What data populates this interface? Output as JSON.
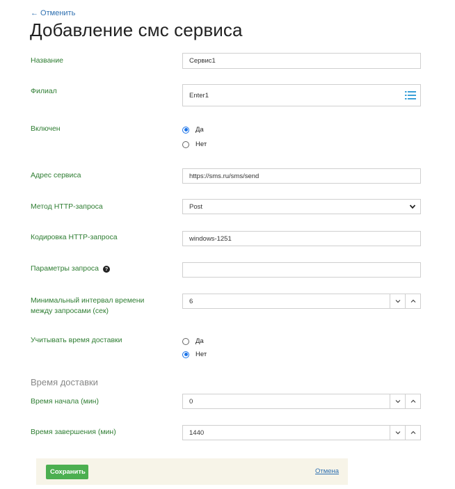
{
  "header": {
    "back_label": "← Отменить",
    "title": "Добавление смс сервиса"
  },
  "form": {
    "name": {
      "label": "Название",
      "value": "Сервис1"
    },
    "branch": {
      "label": "Филиал",
      "value": "Enter1",
      "icon": "list-icon"
    },
    "enabled": {
      "label": "Включен",
      "options": [
        {
          "label": "Да",
          "checked": true
        },
        {
          "label": "Нет",
          "checked": false
        }
      ]
    },
    "service_address": {
      "label": "Адрес сервиса",
      "value": "https://sms.ru/sms/send"
    },
    "http_method": {
      "label": "Метод HTTP-запроса",
      "value": "Post"
    },
    "http_encoding": {
      "label": "Кодировка HTTP-запроса",
      "value": "windows-1251"
    },
    "request_params": {
      "label": "Параметры запроса",
      "value": ""
    },
    "min_interval": {
      "label_line1": "Минимальный интервал времени",
      "label_line2": "между запросами (сек)",
      "value": "6"
    },
    "consider_delivery_time": {
      "label": "Учитывать время доставки",
      "options": [
        {
          "label": "Да",
          "checked": false
        },
        {
          "label": "Нет",
          "checked": true
        }
      ]
    },
    "delivery_section_title": "Время доставки",
    "start_time": {
      "label": "Время начала (мин)",
      "value": "0"
    },
    "end_time": {
      "label": "Время завершения (мин)",
      "value": "1440"
    }
  },
  "footer": {
    "save_label": "Сохранить",
    "cancel_label": "Отмена"
  },
  "colors": {
    "label_green": "#2e7d32",
    "link_blue": "#2d6fb0",
    "save_green": "#4caf50",
    "footer_bg": "#f7f4e8",
    "radio_blue": "#1a73e8"
  }
}
